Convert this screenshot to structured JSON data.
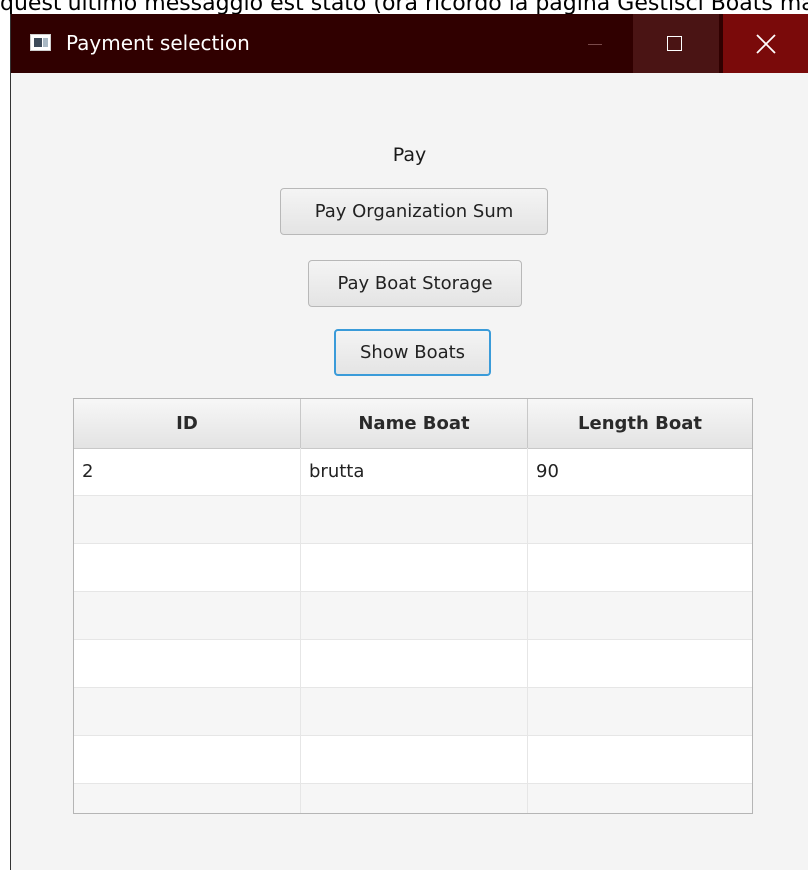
{
  "background_text": "quest'ultimo messaggio est stato (ora ricordo la pagina Gestisci Boats ma e non si riesce a trovare la pagina dove c'e scritto il pagamento)",
  "window": {
    "title": "Payment selection",
    "icon": "app-window-icon",
    "controls": {
      "minimize_icon": "minimize-icon",
      "maximize_icon": "maximize-icon",
      "close_icon": "close-icon"
    },
    "colors": {
      "titlebar": "#300000",
      "maximize_bg": "#4a1414",
      "close_bg": "#7a0a0a",
      "focus_accent": "#3a9bd9"
    }
  },
  "content": {
    "label": "Pay",
    "buttons": {
      "pay_org": "Pay Organization Sum",
      "pay_storage": "Pay Boat Storage",
      "show_boats": "Show Boats"
    }
  },
  "table": {
    "columns": [
      "ID",
      "Name Boat",
      "Length Boat"
    ],
    "rows": [
      [
        "2",
        "brutta",
        "90"
      ],
      [
        "",
        "",
        ""
      ],
      [
        "",
        "",
        ""
      ],
      [
        "",
        "",
        ""
      ],
      [
        "",
        "",
        ""
      ],
      [
        "",
        "",
        ""
      ],
      [
        "",
        "",
        ""
      ],
      [
        "",
        "",
        ""
      ]
    ]
  }
}
